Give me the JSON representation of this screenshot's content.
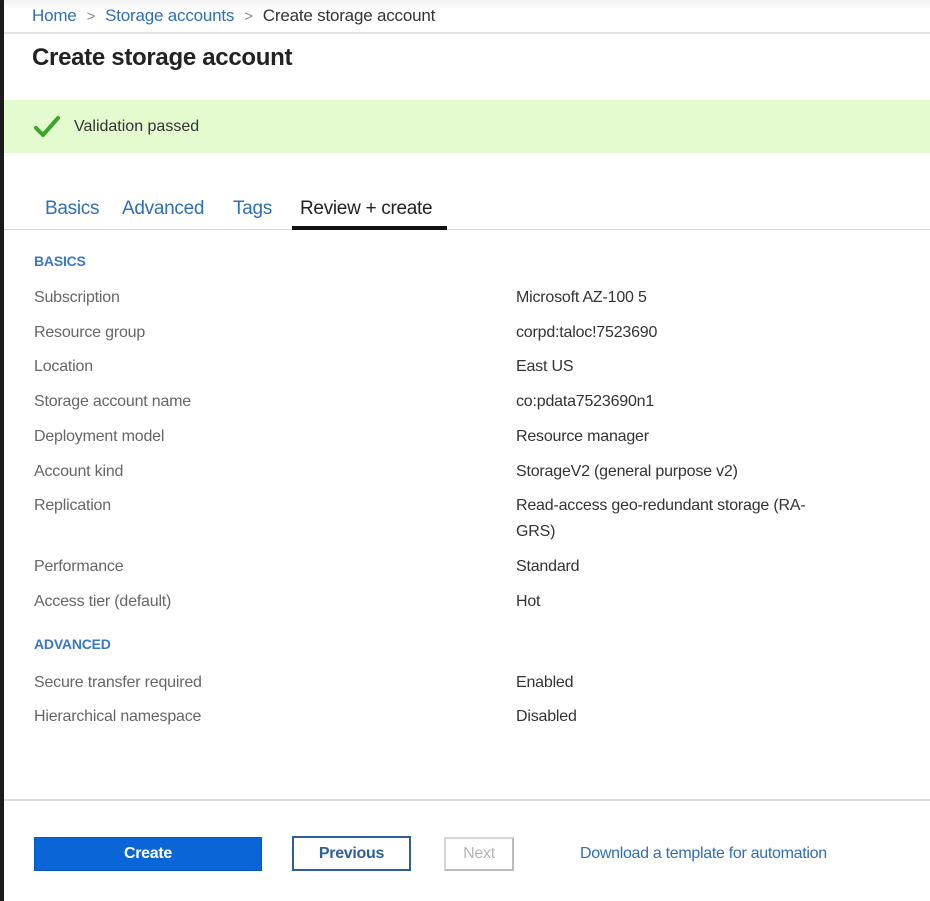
{
  "breadcrumb": {
    "items": [
      {
        "label": "Home",
        "link": true
      },
      {
        "label": "Storage accounts",
        "link": true
      },
      {
        "label": "Create storage account",
        "link": false
      }
    ],
    "separator": ">"
  },
  "page": {
    "title": "Create storage account"
  },
  "validation": {
    "icon": "checkmark-icon",
    "text": "Validation passed",
    "color": "#e3fbcf",
    "icon_color": "#3aa52b"
  },
  "tabs": [
    {
      "label": "Basics",
      "active": false
    },
    {
      "label": "Advanced",
      "active": false
    },
    {
      "label": "Tags",
      "active": false
    },
    {
      "label": "Review + create",
      "active": true
    }
  ],
  "sections": {
    "basics": {
      "title": "BASICS",
      "rows": [
        {
          "label": "Subscription",
          "value": "Microsoft AZ-100 5"
        },
        {
          "label": "Resource group",
          "value": "corpd:taloc!7523690"
        },
        {
          "label": "Location",
          "value": "East US"
        },
        {
          "label": "Storage account name",
          "value": "co:pdata7523690n1"
        },
        {
          "label": "Deployment model",
          "value": "Resource manager"
        },
        {
          "label": "Account kind",
          "value": "StorageV2 (general purpose v2)"
        },
        {
          "label": "Replication",
          "value": "Read-access geo-redundant storage (RA-GRS)"
        },
        {
          "label": "Performance",
          "value": "Standard"
        },
        {
          "label": "Access tier (default)",
          "value": "Hot"
        }
      ]
    },
    "advanced": {
      "title": "ADVANCED",
      "rows": [
        {
          "label": "Secure transfer required",
          "value": "Enabled"
        },
        {
          "label": "Hierarchical namespace",
          "value": "Disabled"
        }
      ]
    }
  },
  "footer": {
    "create_label": "Create",
    "previous_label": "Previous",
    "next_label": "Next",
    "next_disabled": true,
    "download_link": "Download a template for automation",
    "accent_color": "#0a66d6"
  }
}
